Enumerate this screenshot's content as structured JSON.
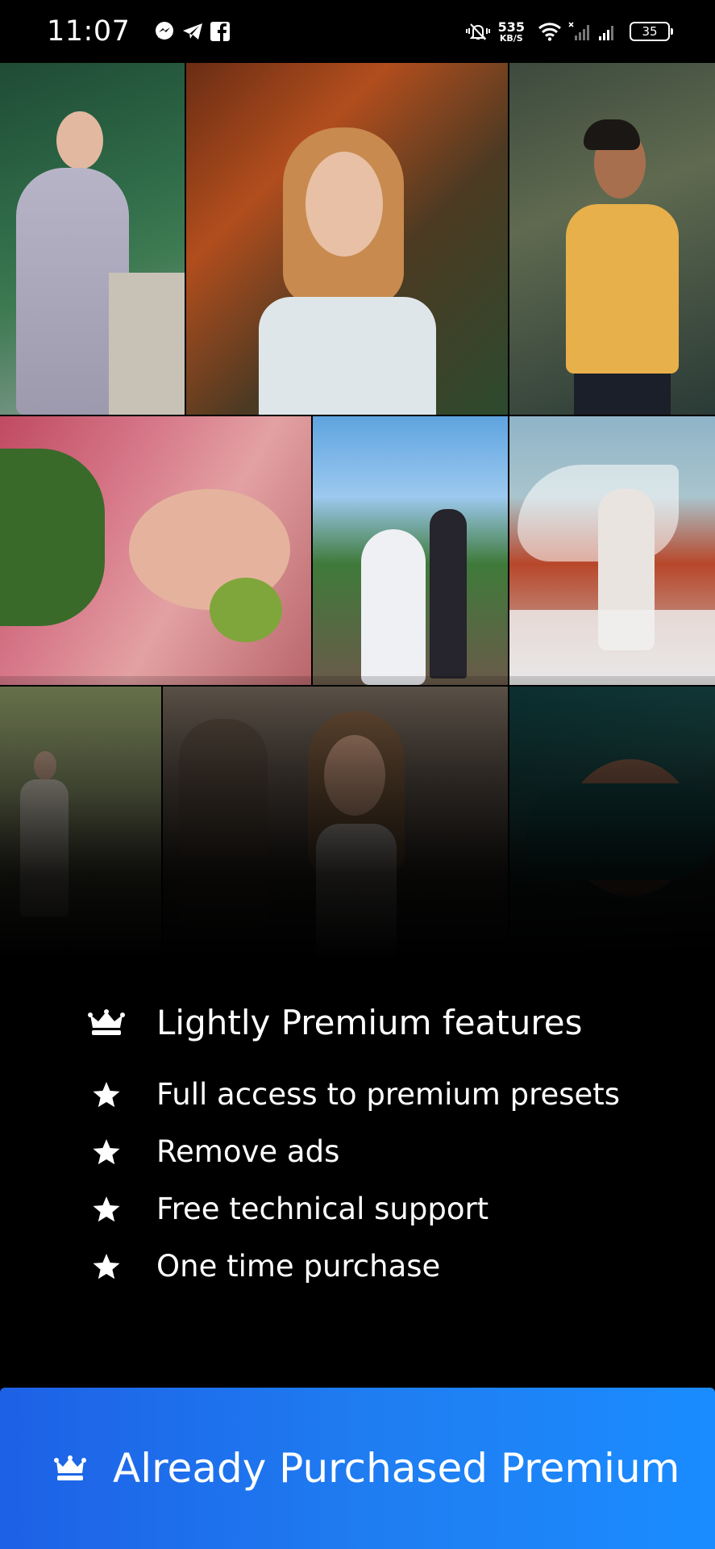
{
  "status_bar": {
    "time": "11:07",
    "net_speed_value": "535",
    "net_speed_unit": "KB/S",
    "battery_level": "35"
  },
  "colors": {
    "background": "#000000",
    "text": "#ffffff",
    "button_start": "#1d61e6",
    "button_end": "#1a8cff"
  },
  "icons": {
    "status_left": [
      "messenger-icon",
      "telegram-icon",
      "facebook-icon"
    ],
    "status_right": [
      "mute-icon",
      "wifi-icon",
      "signal-icon",
      "battery-icon"
    ],
    "feature_title": "crown-icon",
    "feature_item": "star-icon",
    "button": "crown-icon"
  },
  "features": {
    "title": "Lightly Premium features",
    "items": [
      {
        "label": "Full access to premium presets"
      },
      {
        "label": "Remove ads"
      },
      {
        "label": "Free technical support"
      },
      {
        "label": "One time purchase"
      }
    ]
  },
  "purchase_button": {
    "label": "Already Purchased Premium"
  }
}
